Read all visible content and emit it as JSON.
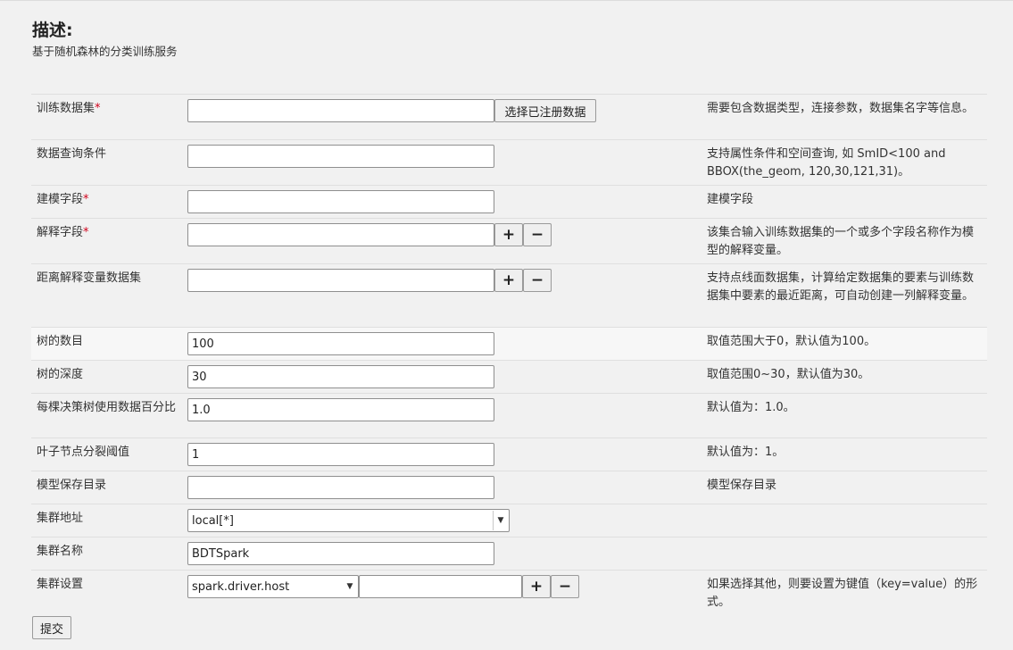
{
  "description": {
    "title": "描述:",
    "text": "基于随机森林的分类训练服务"
  },
  "rows": {
    "train_dataset": {
      "label": "训练数据集",
      "required_mark": "*",
      "value": "",
      "select_button": "选择已注册数据",
      "help": "需要包含数据类型，连接参数，数据集名字等信息。"
    },
    "query": {
      "label": "数据查询条件",
      "value": "",
      "help": "支持属性条件和空间查询, 如 SmID<100 and BBOX(the_geom, 120,30,121,31)。"
    },
    "model_field": {
      "label": "建模字段",
      "required_mark": "*",
      "value": "",
      "help": "建模字段"
    },
    "explain_field": {
      "label": "解释字段",
      "required_mark": "*",
      "value": "",
      "help": "该集合输入训练数据集的一个或多个字段名称作为模型的解释变量。"
    },
    "distance_dataset": {
      "label": "距离解释变量数据集",
      "value": "",
      "help": "支持点线面数据集，计算给定数据集的要素与训练数据集中要素的最近距离，可自动创建一列解释变量。"
    },
    "tree_count": {
      "label": "树的数目",
      "value": "100",
      "help": "取值范围大于0，默认值为100。"
    },
    "tree_depth": {
      "label": "树的深度",
      "value": "30",
      "help": "取值范围0~30，默认值为30。"
    },
    "sample_ratio": {
      "label": "每棵决策树使用数据百分比",
      "value": "1.0",
      "help": "默认值为：1.0。"
    },
    "split_threshold": {
      "label": "叶子节点分裂阈值",
      "value": "1",
      "help": "默认值为：1。"
    },
    "model_dir": {
      "label": "模型保存目录",
      "value": "",
      "help": "模型保存目录"
    },
    "cluster_address": {
      "label": "集群地址",
      "selected": "local[*]"
    },
    "cluster_name": {
      "label": "集群名称",
      "value": "BDTSpark"
    },
    "cluster_settings": {
      "label": "集群设置",
      "selected_key": "spark.driver.host",
      "value": "",
      "help": "如果选择其他，则要设置为键值（key=value）的形式。"
    }
  },
  "icons": {
    "add": "+",
    "remove": "−",
    "caret": "▼"
  },
  "submit_label": "提交"
}
